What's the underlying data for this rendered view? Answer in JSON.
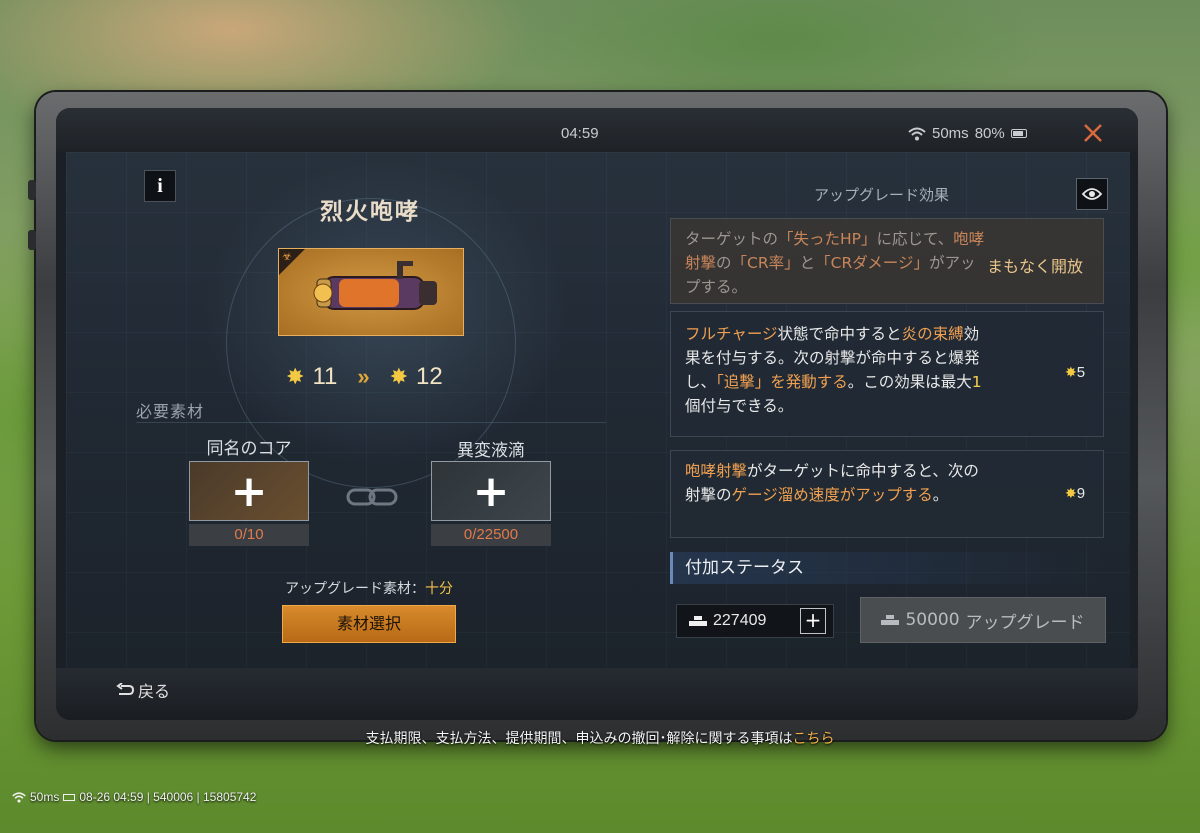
{
  "topbar": {
    "time": "04:59",
    "ping": "50ms",
    "battery": "80%"
  },
  "weapon": {
    "name": "烈火咆哮",
    "star_from": "11",
    "star_to": "12"
  },
  "materials": {
    "title": "必要素材",
    "core": {
      "label": "同名のコア",
      "count": "0/10"
    },
    "liquid": {
      "label": "異変液滴",
      "count": "0/22500"
    },
    "upgrade_material_label": "アップグレード素材：",
    "upgrade_material_status": "十分",
    "select_button": "素材選択"
  },
  "effects": {
    "header": "アップグレード効果",
    "items": [
      {
        "locked": true,
        "status": "まもなく開放"
      },
      {
        "locked": false,
        "star_req": "5"
      },
      {
        "locked": false,
        "star_req": "9"
      }
    ]
  },
  "extra_status": {
    "label": "付加ステータス"
  },
  "currency": {
    "amount": "227409"
  },
  "upgrade": {
    "cost": "50000",
    "label": "アップグレード"
  },
  "nav": {
    "back": "戻る"
  },
  "legal": {
    "text": "支払期限、支払方法、提供期間、申込みの撤回･解除に関する事項は",
    "link": "こちら"
  },
  "status_bar": {
    "ping": "50ms",
    "info": "08-26 04:59 | 540006 | 15805742"
  },
  "icons": [
    "info-icon",
    "eye-icon",
    "close-icon",
    "wifi-icon",
    "battery-icon",
    "star-icon",
    "chevron-right-icon",
    "plus-icon",
    "link-icon",
    "gold-icon",
    "back-arrow-icon"
  ],
  "colors": {
    "accent_orange": "#d88a2c",
    "highlight": "#f0a050",
    "star": "#f3c843",
    "count_red": "#e07a4a"
  }
}
